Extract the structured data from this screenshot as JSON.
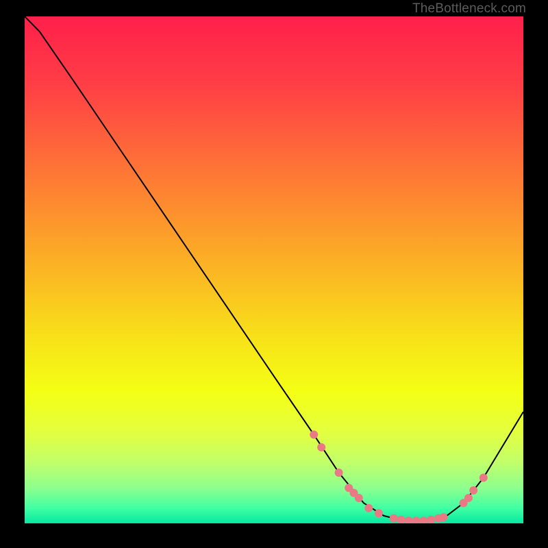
{
  "watermark": "TheBottleneck.com",
  "chart_data": {
    "type": "line",
    "title": "",
    "xlabel": "",
    "ylabel": "",
    "xlim": [
      0,
      100
    ],
    "ylim": [
      0,
      100
    ],
    "grid": false,
    "series": [
      {
        "name": "bottleneck-curve",
        "x": [
          0,
          3,
          10,
          20,
          30,
          40,
          50,
          58,
          63,
          68,
          72,
          76,
          80,
          84,
          88,
          92,
          100
        ],
        "y": [
          100,
          97,
          87,
          72.5,
          58,
          43.5,
          29,
          17.5,
          10,
          4,
          1.5,
          0.5,
          0.5,
          1,
          4,
          9,
          22
        ],
        "stroke": "#000000",
        "stroke_width": 2
      }
    ],
    "highlight_dots": {
      "name": "data-dots",
      "fill": "#e97a85",
      "radius": 6,
      "points": [
        {
          "x": 58,
          "y": 17.5
        },
        {
          "x": 59.5,
          "y": 15
        },
        {
          "x": 63,
          "y": 10
        },
        {
          "x": 65,
          "y": 7
        },
        {
          "x": 66,
          "y": 6
        },
        {
          "x": 67,
          "y": 5
        },
        {
          "x": 69,
          "y": 3
        },
        {
          "x": 71,
          "y": 2
        },
        {
          "x": 74,
          "y": 1
        },
        {
          "x": 75.5,
          "y": 0.7
        },
        {
          "x": 77,
          "y": 0.5
        },
        {
          "x": 78.5,
          "y": 0.5
        },
        {
          "x": 80,
          "y": 0.5
        },
        {
          "x": 81.5,
          "y": 0.7
        },
        {
          "x": 83,
          "y": 1
        },
        {
          "x": 84,
          "y": 1.2
        },
        {
          "x": 88,
          "y": 4
        },
        {
          "x": 89,
          "y": 5
        },
        {
          "x": 90,
          "y": 6.5
        },
        {
          "x": 92,
          "y": 9
        }
      ]
    },
    "background_gradient": {
      "stops": [
        {
          "pct": 0,
          "color": "#ff1f4b"
        },
        {
          "pct": 14,
          "color": "#ff4045"
        },
        {
          "pct": 30,
          "color": "#fe7436"
        },
        {
          "pct": 46,
          "color": "#fca827"
        },
        {
          "pct": 62,
          "color": "#f8dd1a"
        },
        {
          "pct": 74,
          "color": "#f4ff14"
        },
        {
          "pct": 82,
          "color": "#e3ff3f"
        },
        {
          "pct": 88,
          "color": "#c1ff6a"
        },
        {
          "pct": 93,
          "color": "#8eff8e"
        },
        {
          "pct": 97,
          "color": "#41ffa3"
        },
        {
          "pct": 100,
          "color": "#05e8a2"
        }
      ]
    }
  }
}
